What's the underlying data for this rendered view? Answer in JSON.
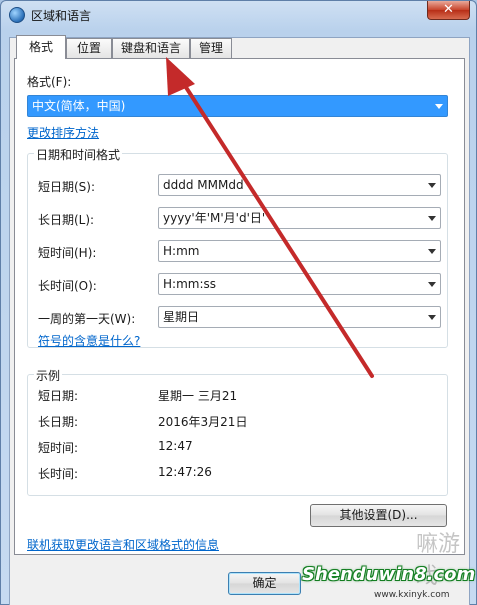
{
  "window": {
    "title": "区域和语言",
    "close_glyph": "✕"
  },
  "tabs": [
    {
      "label": "格式",
      "active": true
    },
    {
      "label": "位置",
      "active": false
    },
    {
      "label": "键盘和语言",
      "active": false
    },
    {
      "label": "管理",
      "active": false
    }
  ],
  "format": {
    "label": "格式(F):",
    "selected": "中文(简体，中国)",
    "sort_link": "更改排序方法"
  },
  "datetime_group": {
    "title": "日期和时间格式",
    "rows": [
      {
        "label": "短日期(S):",
        "value": "dddd  MMMdd"
      },
      {
        "label": "长日期(L):",
        "value": "yyyy'年'M'月'd'日'"
      },
      {
        "label": "短时间(H):",
        "value": "H:mm"
      },
      {
        "label": "长时间(O):",
        "value": "H:mm:ss"
      },
      {
        "label": "一周的第一天(W):",
        "value": "星期日"
      }
    ],
    "symbols_link": "符号的含意是什么?"
  },
  "examples": {
    "title": "示例",
    "rows": [
      {
        "label": "短日期:",
        "value": "星期一  三月21"
      },
      {
        "label": "长日期:",
        "value": "2016年3月21日"
      },
      {
        "label": "短时间:",
        "value": "12:47"
      },
      {
        "label": "长时间:",
        "value": "12:47:26"
      }
    ]
  },
  "buttons": {
    "other_settings": "其他设置(D)...",
    "ok": "确定"
  },
  "online_link": "联机获取更改语言和区域格式的信息",
  "watermark": {
    "main": "Shenduwin8.com",
    "sub": "www.kxinyk.com",
    "seal": "嘛游戏"
  },
  "colors": {
    "arrow": "#c42a2a",
    "link": "#0066cc",
    "selection": "#3399ff"
  }
}
